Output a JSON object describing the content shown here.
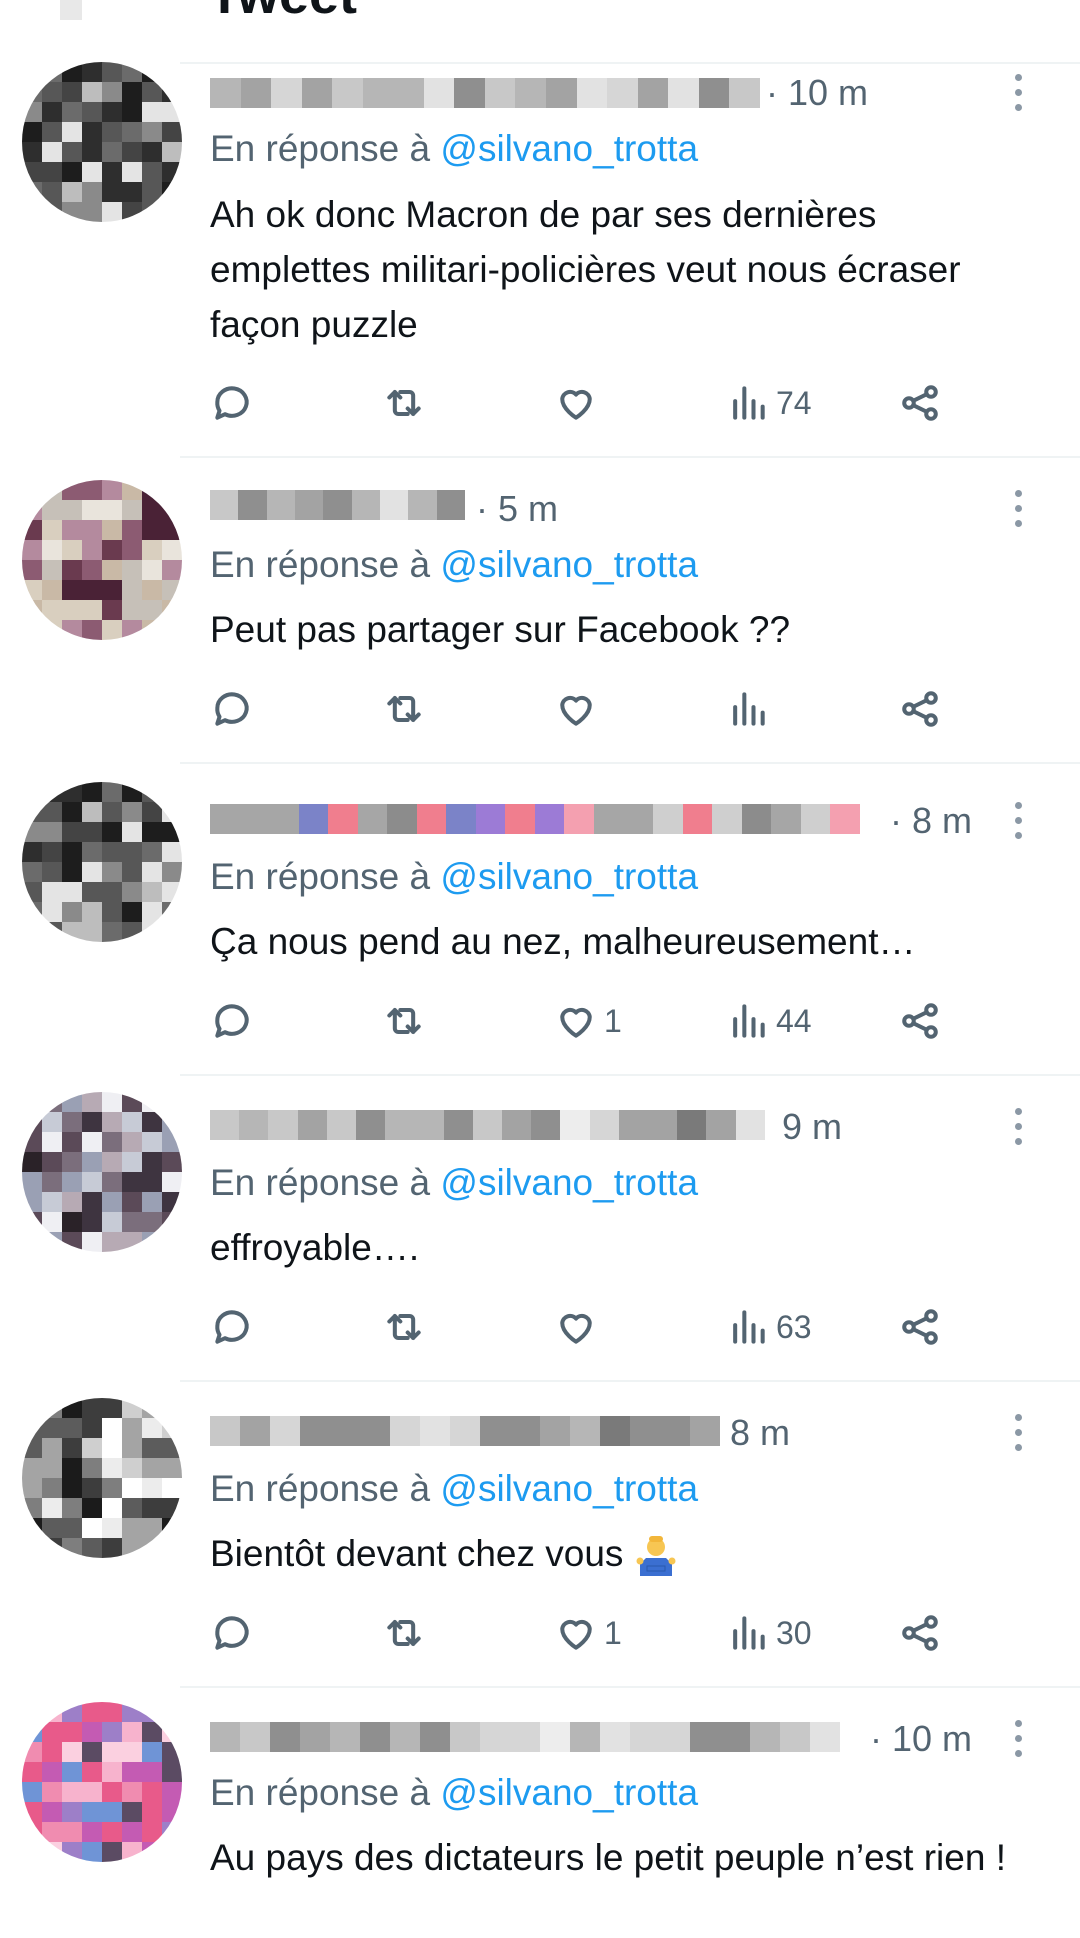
{
  "header": {
    "title": "Tweet"
  },
  "colors": {
    "accent": "#1d9bf0",
    "muted": "#536471",
    "text": "#0f1419",
    "divider": "#eff3f4"
  },
  "tweets": [
    {
      "time": "· 10 m",
      "reply_prefix": "En réponse à ",
      "handle": "@silvano_trotta",
      "text": "Ah ok donc Macron de par ses dernières emplettes militari-policières veut nous écraser façon puzzle",
      "likes": "",
      "views": "74"
    },
    {
      "time": "· 5 m",
      "reply_prefix": "En réponse à ",
      "handle": "@silvano_trotta",
      "text": "Peut pas partager sur Facebook ??",
      "likes": "",
      "views": ""
    },
    {
      "time": "· 8 m",
      "reply_prefix": "En réponse à ",
      "handle": "@silvano_trotta",
      "text": "Ça nous pend au nez, malheureusement…",
      "likes": "1",
      "views": "44"
    },
    {
      "time": "9 m",
      "reply_prefix": "En réponse à ",
      "handle": "@silvano_trotta",
      "text": "effroyable….",
      "likes": "",
      "views": "63"
    },
    {
      "time": "8 m",
      "reply_prefix": "En réponse à ",
      "handle": "@silvano_trotta",
      "text": "Bientôt devant chez vous",
      "emoji": "shrug-emoji",
      "likes": "1",
      "views": "30"
    },
    {
      "time": "· 10 m",
      "reply_prefix": "En réponse à ",
      "handle": "@silvano_trotta",
      "text": "Au pays des dictateurs le petit peuple n’est rien !",
      "likes": "",
      "views": ""
    }
  ],
  "icons": [
    "reply-icon",
    "retweet-icon",
    "like-icon",
    "views-icon",
    "share-icon",
    "more-icon"
  ]
}
